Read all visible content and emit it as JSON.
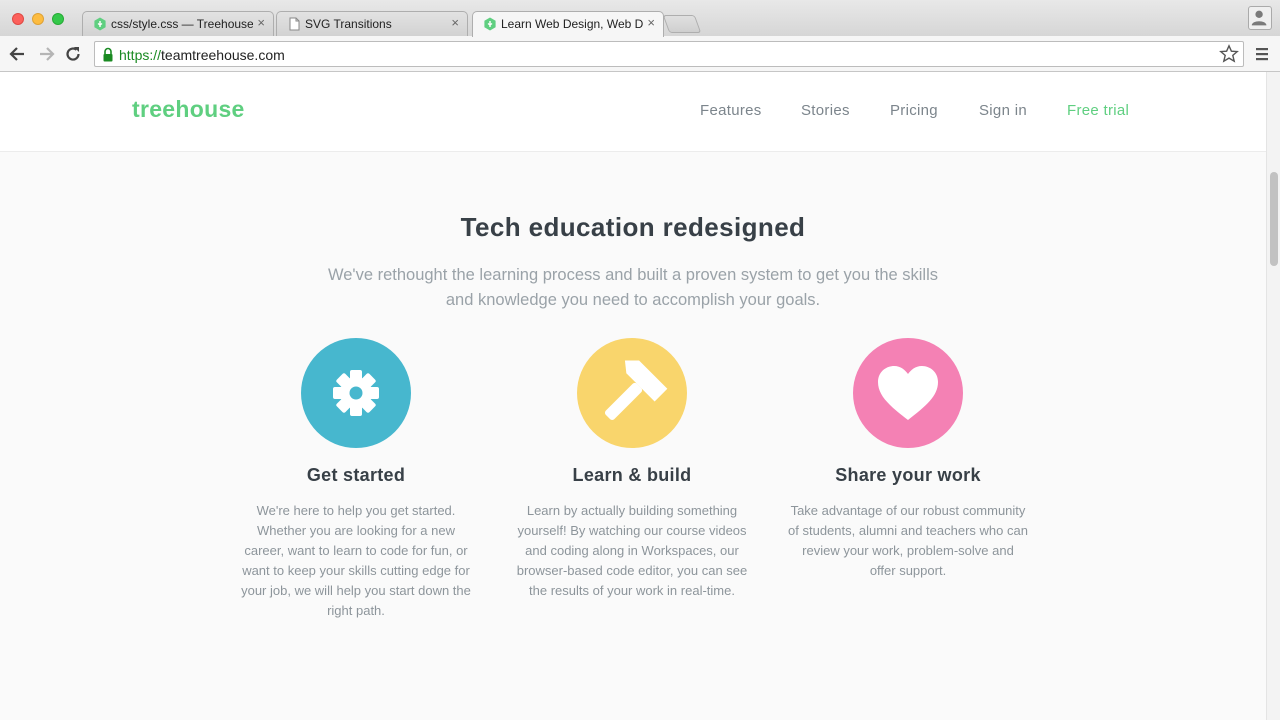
{
  "browser": {
    "tabs": [
      {
        "title": "css/style.css — Treehouse",
        "favicon": "treehouse-favicon",
        "active": false
      },
      {
        "title": "SVG Transitions",
        "favicon": "page-icon",
        "active": false
      },
      {
        "title": "Learn Web Design, Web Development",
        "favicon": "treehouse-favicon",
        "active": true
      }
    ],
    "tab_close_glyph": "×",
    "url_scheme": "https://",
    "url_host": "teamtreehouse.com"
  },
  "site": {
    "logo": "treehouse",
    "nav": [
      "Features",
      "Stories",
      "Pricing",
      "Sign in",
      "Free trial"
    ],
    "accent_color": "#5fcf80"
  },
  "hero": {
    "title": "Tech education redesigned",
    "subtitle": "We've rethought the learning process and built a proven system to get you the skills and knowledge you need to accomplish your goals."
  },
  "features": [
    {
      "icon": "gear-icon",
      "color": "#47b7ce",
      "title": "Get started",
      "description": "We're here to help you get started. Whether you are looking for a new career, want to learn to code for fun, or want to keep your skills cutting edge for your job, we will help you start down the right path."
    },
    {
      "icon": "hammer-icon",
      "color": "#f9d56c",
      "title": "Learn & build",
      "description": "Learn by actually building something yourself! By watching our course videos and coding along in Workspaces, our browser-based code editor, you can see the results of your work in real-time."
    },
    {
      "icon": "heart-icon",
      "color": "#f481b4",
      "title": "Share your work",
      "description": "Take advantage of our robust community of students, alumni and teachers who can review your work, problem-solve and offer support."
    }
  ]
}
